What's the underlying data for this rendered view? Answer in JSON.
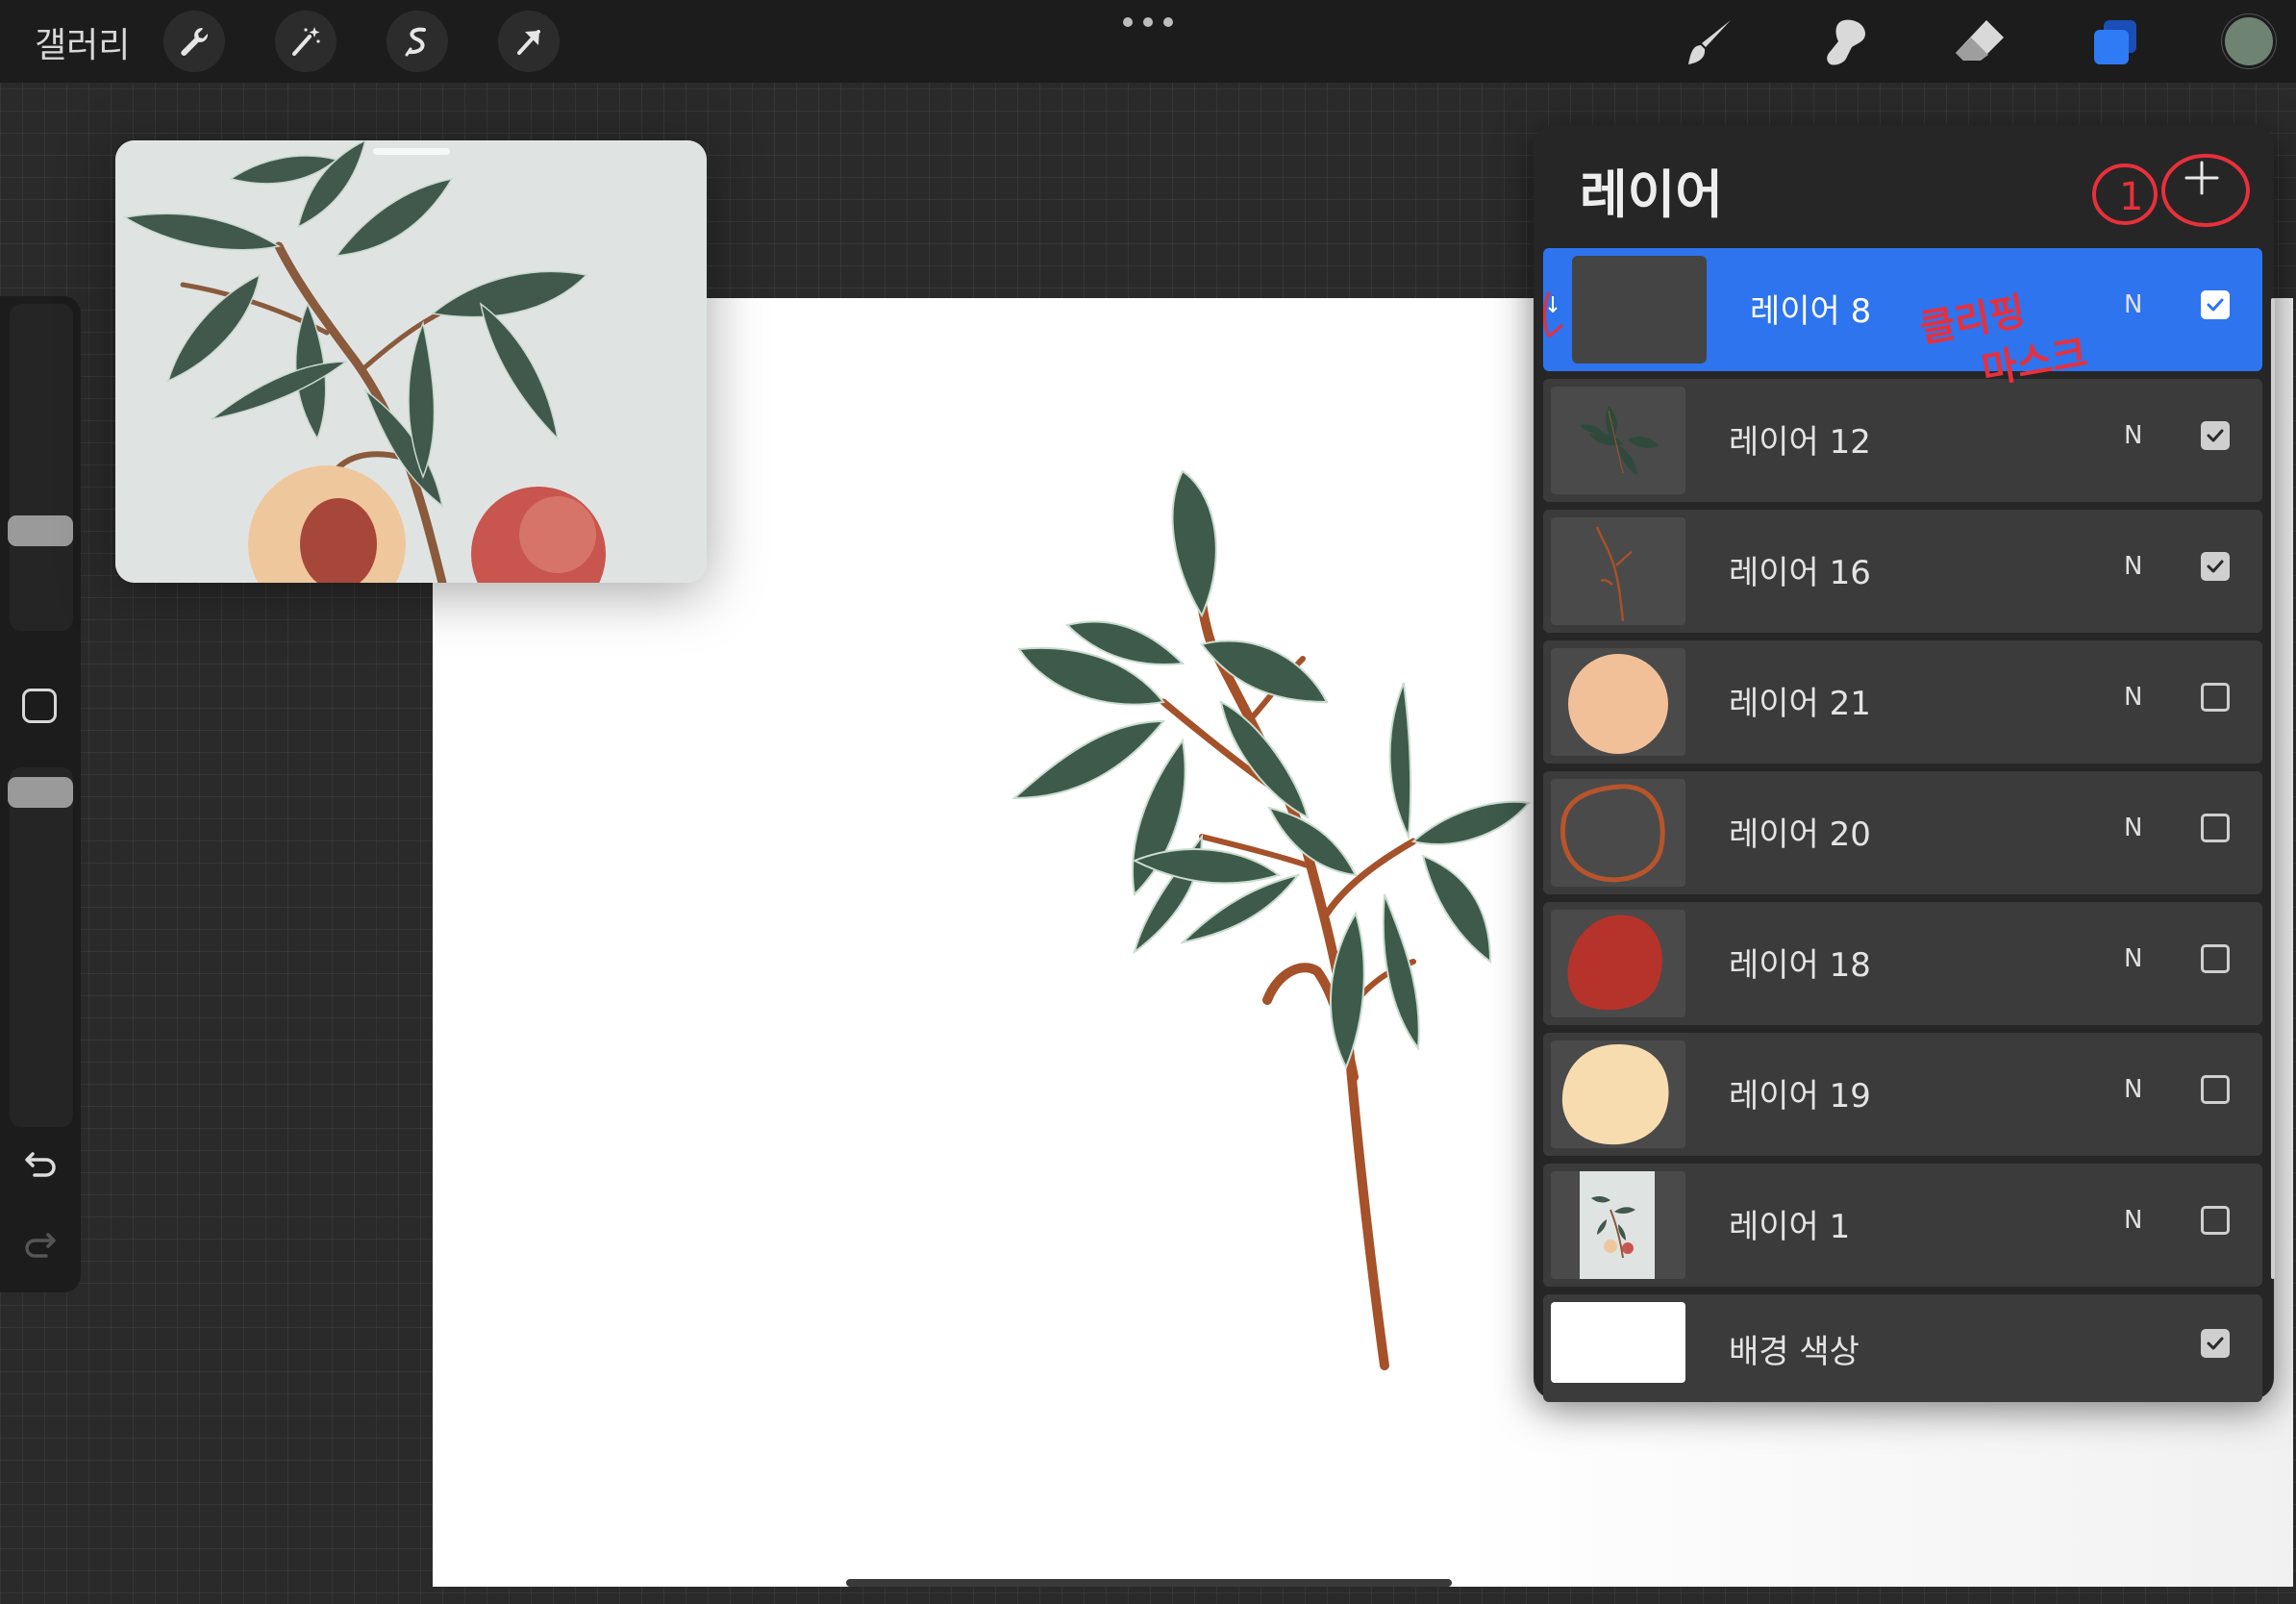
{
  "topbar": {
    "gallery_label": "갤러리",
    "left_tools": [
      "wrench-icon",
      "magic-wand-icon",
      "selection-icon",
      "transform-arrow-icon"
    ],
    "right_tools": [
      "brush-icon",
      "smudge-icon",
      "eraser-icon",
      "layers-icon"
    ],
    "active_tool": "layers-icon",
    "current_color": "#6e8372"
  },
  "sidebar": {
    "brush_size_level": 0.35,
    "opacity_level": 0.65,
    "undo_icon": "undo-icon",
    "redo_icon": "redo-icon"
  },
  "layers_panel": {
    "title": "레이어",
    "add_icon": "plus-icon",
    "annotation_number": "1",
    "annotation_text_line1": "클리핑",
    "annotation_text_line2": "마스크",
    "layers": [
      {
        "name": "레이어 8",
        "blend": "N",
        "visible": true,
        "selected": true,
        "clipping": true,
        "thumb": "dark"
      },
      {
        "name": "레이어 12",
        "blend": "N",
        "visible": true,
        "selected": false,
        "thumb": "leaves"
      },
      {
        "name": "레이어 16",
        "blend": "N",
        "visible": true,
        "selected": false,
        "thumb": "stem"
      },
      {
        "name": "레이어 21",
        "blend": "N",
        "visible": false,
        "selected": false,
        "thumb": "peach-circle"
      },
      {
        "name": "레이어 20",
        "blend": "N",
        "visible": false,
        "selected": false,
        "thumb": "outline-circle"
      },
      {
        "name": "레이어 18",
        "blend": "N",
        "visible": false,
        "selected": false,
        "thumb": "red-blob"
      },
      {
        "name": "레이어 19",
        "blend": "N",
        "visible": false,
        "selected": false,
        "thumb": "cream-blob"
      },
      {
        "name": "레이어 1",
        "blend": "N",
        "visible": false,
        "selected": false,
        "thumb": "reference-photo"
      }
    ],
    "background": {
      "name": "배경 색상",
      "visible": true,
      "color": "#ffffff"
    }
  },
  "colors": {
    "accent": "#2d74ee",
    "leaf": "#3d5a4a",
    "stem": "#a5512a",
    "peach": "#f2c098",
    "red": "#b5332a",
    "cream": "#f7dcb0",
    "annotation": "#e8303b"
  }
}
